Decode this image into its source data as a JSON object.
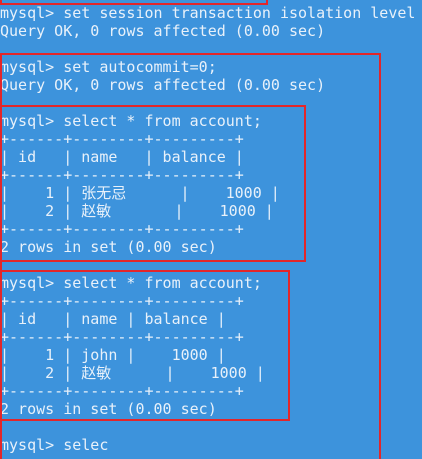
{
  "terminal": {
    "lines": [
      "mysql> set session transaction isolation level",
      "Query OK, 0 rows affected (0.00 sec)",
      "",
      "mysql> set autocommit=0;",
      "Query OK, 0 rows affected (0.00 sec)",
      "",
      "mysql> select * from account;",
      "+------+--------+---------+",
      "| id   | name   | balance |",
      "+------+--------+---------+",
      "|    1 | 张无忌      |    1000 |",
      "|    2 | 赵敏       |    1000 |",
      "+------+--------+---------+",
      "2 rows in set (0.00 sec)",
      "",
      "mysql> select * from account;",
      "+------+--------+---------+",
      "| id   | name | balance |",
      "+------+--------+---------+",
      "|    1 | john |    1000 |",
      "|    2 | 赵敏      |    1000 |",
      "+------+--------+---------+",
      "2 rows in set (0.00 sec)",
      "",
      "mysql> selec"
    ]
  }
}
